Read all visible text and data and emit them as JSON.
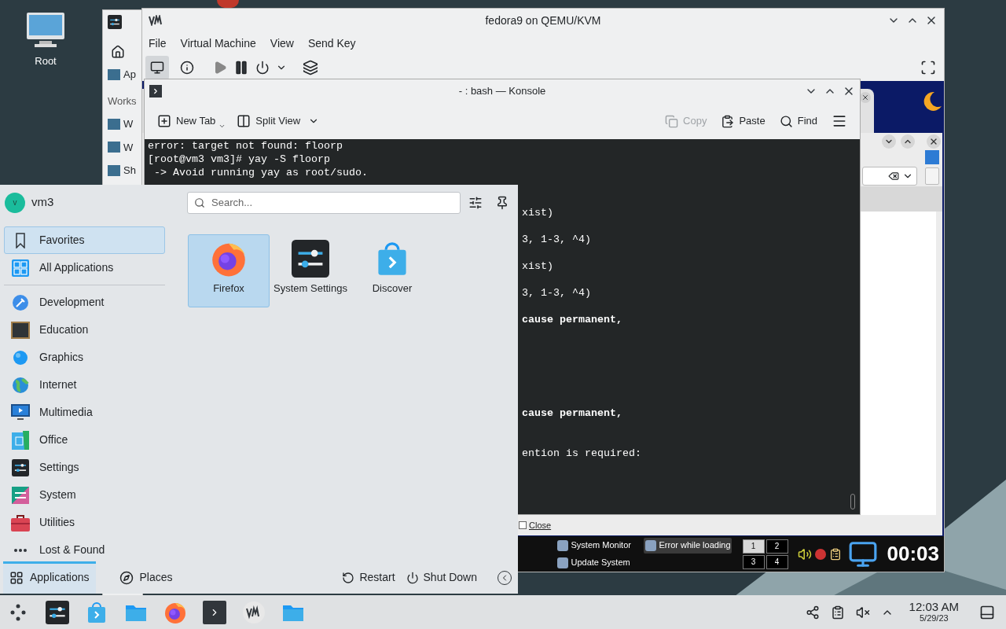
{
  "desktop_icons": [
    {
      "label": "Root"
    }
  ],
  "back_window": {
    "items": [
      {
        "kind": "entry",
        "label": "Ap"
      },
      {
        "kind": "header",
        "label": "Works"
      },
      {
        "kind": "entry",
        "label": "W"
      },
      {
        "kind": "entry",
        "label": "W"
      },
      {
        "kind": "entry",
        "label": "Sh"
      }
    ]
  },
  "vm_window": {
    "title": "fedora9 on QEMU/KVM",
    "menu": [
      "File",
      "Virtual Machine",
      "View",
      "Send Key"
    ],
    "view_buttons": [
      {
        "selected": true
      },
      {
        "selected": false
      }
    ],
    "guest": {
      "close_option": {
        "label": "Close",
        "checked": false
      },
      "taskbar": {
        "tasks": [
          {
            "label": "System Monitor",
            "selected": false
          },
          {
            "label": "Error while loading",
            "selected": true
          },
          {
            "label": "Update System",
            "selected": false
          }
        ],
        "pager": [
          {
            "label": "1",
            "selected": true
          },
          {
            "label": "2",
            "selected": false
          },
          {
            "label": "3",
            "selected": false
          },
          {
            "label": "4",
            "selected": false
          }
        ],
        "clock": "00:03"
      }
    }
  },
  "konsole": {
    "title": "- : bash — Konsole",
    "left_actions": [
      {
        "label": "New Tab"
      },
      {
        "label": "Split View"
      }
    ],
    "right_actions": [
      {
        "label": "Copy",
        "disabled": true
      },
      {
        "label": "Paste",
        "disabled": false
      },
      {
        "label": "Find",
        "disabled": false
      }
    ],
    "lines": [
      {
        "kind": "full",
        "text": "error: target not found: floorp"
      },
      {
        "kind": "full",
        "text": "[root@vm3 vm3]# yay -S floorp"
      },
      {
        "kind": "full",
        "text": " -> Avoid running yay as root/sudo."
      },
      {
        "kind": "blank"
      },
      {
        "kind": "blank"
      },
      {
        "kind": "tail",
        "text": "xist)",
        "bold": false
      },
      {
        "kind": "blank"
      },
      {
        "kind": "tail",
        "text": "3, 1-3, ^4)",
        "bold": false
      },
      {
        "kind": "blank"
      },
      {
        "kind": "tail",
        "text": "xist)",
        "bold": false
      },
      {
        "kind": "blank"
      },
      {
        "kind": "tail",
        "text": "3, 1-3, ^4)",
        "bold": false
      },
      {
        "kind": "blank"
      },
      {
        "kind": "tail",
        "text": "cause permanent,",
        "bold": true
      },
      {
        "kind": "blank"
      },
      {
        "kind": "blank"
      },
      {
        "kind": "blank"
      },
      {
        "kind": "blank"
      },
      {
        "kind": "blank"
      },
      {
        "kind": "blank"
      },
      {
        "kind": "tail",
        "text": "cause permanent,",
        "bold": true
      },
      {
        "kind": "blank"
      },
      {
        "kind": "blank"
      },
      {
        "kind": "tail",
        "text": "ention is required:",
        "bold": false
      }
    ]
  },
  "launcher": {
    "user": {
      "initial": "v",
      "name": "vm3"
    },
    "search": {
      "placeholder": "Search..."
    },
    "categories": [
      {
        "label": "Favorites",
        "selected": true
      },
      {
        "label": "All Applications",
        "selected": false
      },
      {
        "label": "Development",
        "selected": false
      },
      {
        "label": "Education",
        "selected": false
      },
      {
        "label": "Graphics",
        "selected": false
      },
      {
        "label": "Internet",
        "selected": false
      },
      {
        "label": "Multimedia",
        "selected": false
      },
      {
        "label": "Office",
        "selected": false
      },
      {
        "label": "Settings",
        "selected": false
      },
      {
        "label": "System",
        "selected": false
      },
      {
        "label": "Utilities",
        "selected": false
      },
      {
        "label": "Lost & Found",
        "selected": false
      }
    ],
    "apps": [
      {
        "label": "Firefox",
        "selected": true
      },
      {
        "label": "System Settings",
        "selected": false
      },
      {
        "label": "Discover",
        "selected": false
      }
    ],
    "tabs": [
      {
        "label": "Applications",
        "selected": true
      },
      {
        "label": "Places",
        "selected": false
      }
    ],
    "actions": [
      {
        "label": "Restart"
      },
      {
        "label": "Shut Down"
      }
    ]
  },
  "panel": {
    "clock": {
      "time": "12:03 AM",
      "date": "5/29/23"
    }
  }
}
